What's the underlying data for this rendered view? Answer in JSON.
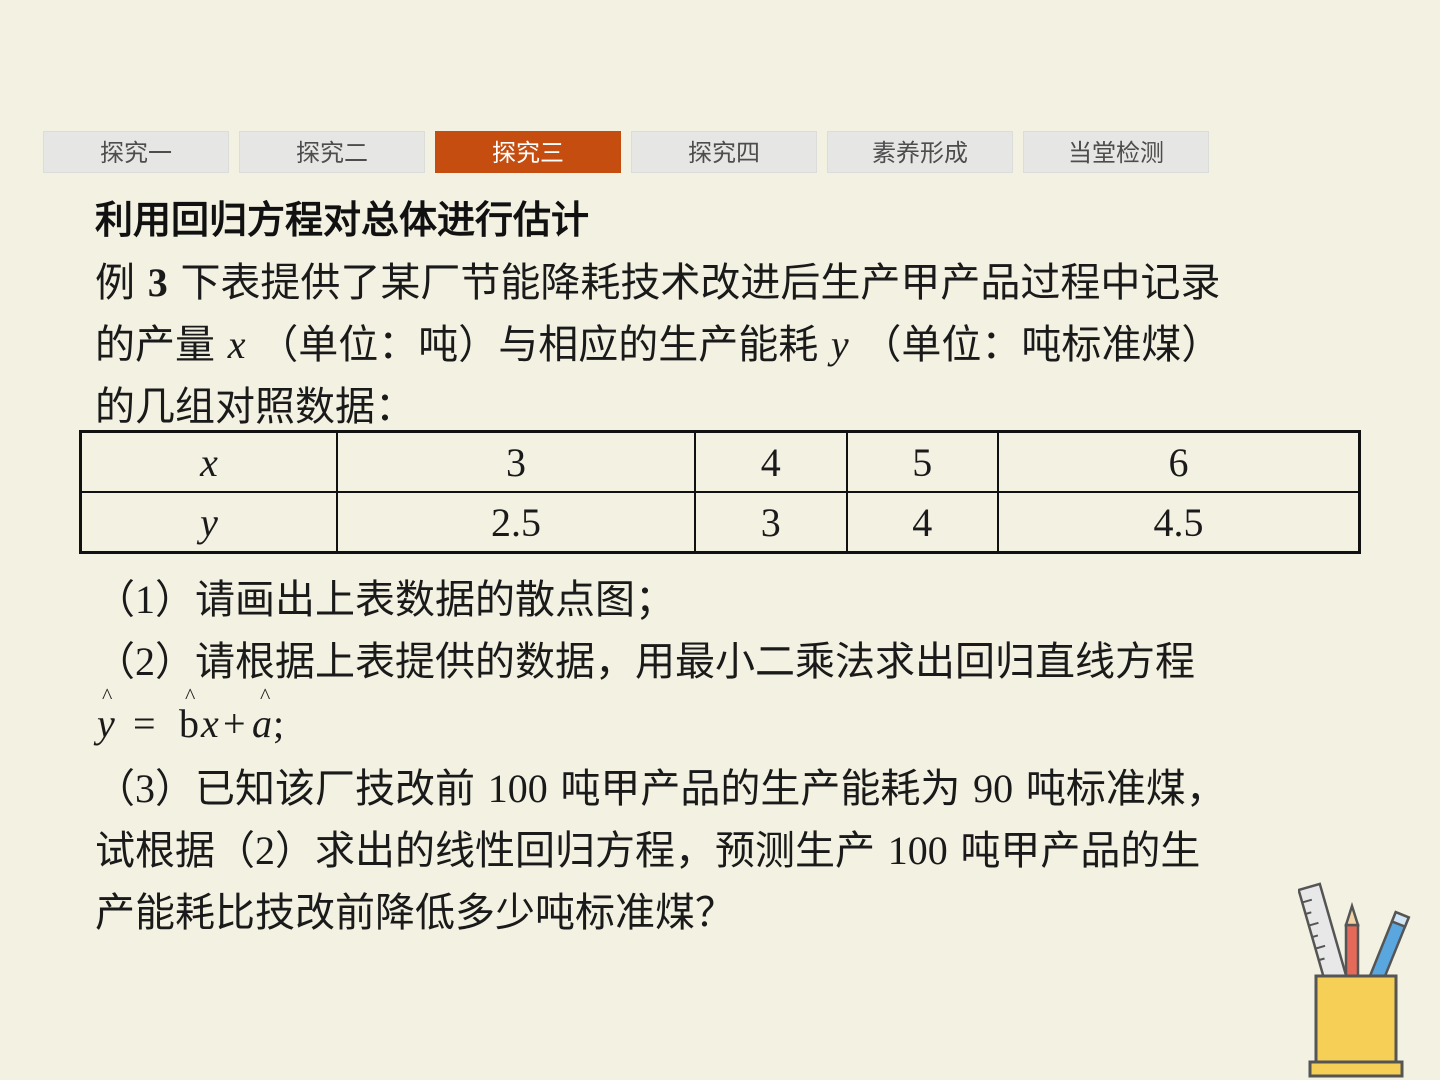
{
  "tabs": [
    {
      "label": "探究一",
      "active": false
    },
    {
      "label": "探究二",
      "active": false
    },
    {
      "label": "探究三",
      "active": true
    },
    {
      "label": "探究四",
      "active": false
    },
    {
      "label": "素养形成",
      "active": false
    },
    {
      "label": "当堂检测",
      "active": false
    }
  ],
  "colors": {
    "active_tab": "#c44d0f",
    "background": "#f3f1e1",
    "inactive_tab": "#e6e6e4"
  },
  "heading": "利用回归方程对总体进行估计",
  "example": {
    "prefix": "例",
    "number": "3",
    "line1_rest": "下表提供了某厂节能降耗技术改进后生产甲产品过程中记录",
    "line2_a": "的产量",
    "var_x": "x",
    "line2_b": "（单位：吨）与相应的生产能耗",
    "var_y": "y",
    "line2_c": "（单位：吨标准煤）",
    "line3": "的几组对照数据："
  },
  "table": {
    "rows": [
      {
        "header": "x",
        "values": [
          "3",
          "4",
          "5",
          "6"
        ]
      },
      {
        "header": "y",
        "values": [
          "2.5",
          "3",
          "4",
          "4.5"
        ]
      }
    ]
  },
  "questions": {
    "q1_open": "（",
    "q1_num": "1",
    "q1_text": "）请画出上表数据的散点图；",
    "q2_open": "（",
    "q2_num": "2",
    "q2_text": "）请根据上表提供的数据，用最小二乘法求出回归直线方程",
    "q3_open": "（",
    "q3_num": "3",
    "q3_text_a": "）已知该厂技改前",
    "q3_n1": "100",
    "q3_text_b": "吨甲产品的生产能耗为",
    "q3_n2": "90",
    "q3_text_c": "吨标准煤，",
    "q3_l2_a": "试根据（",
    "q3_l2_num": "2",
    "q3_l2_b": "）求出的线性回归方程，预测生产",
    "q3_l2_n": "100",
    "q3_l2_c": "吨甲产品的生",
    "q3_l3": "产能耗比技改前降低多少吨标准煤？"
  },
  "formula": {
    "hat": "^",
    "y": "y",
    "eq": "=",
    "b": "b",
    "x": "x",
    "plus": "+",
    "a": "a",
    "end": ";"
  },
  "icons": [
    "pencil-holder-icon"
  ]
}
